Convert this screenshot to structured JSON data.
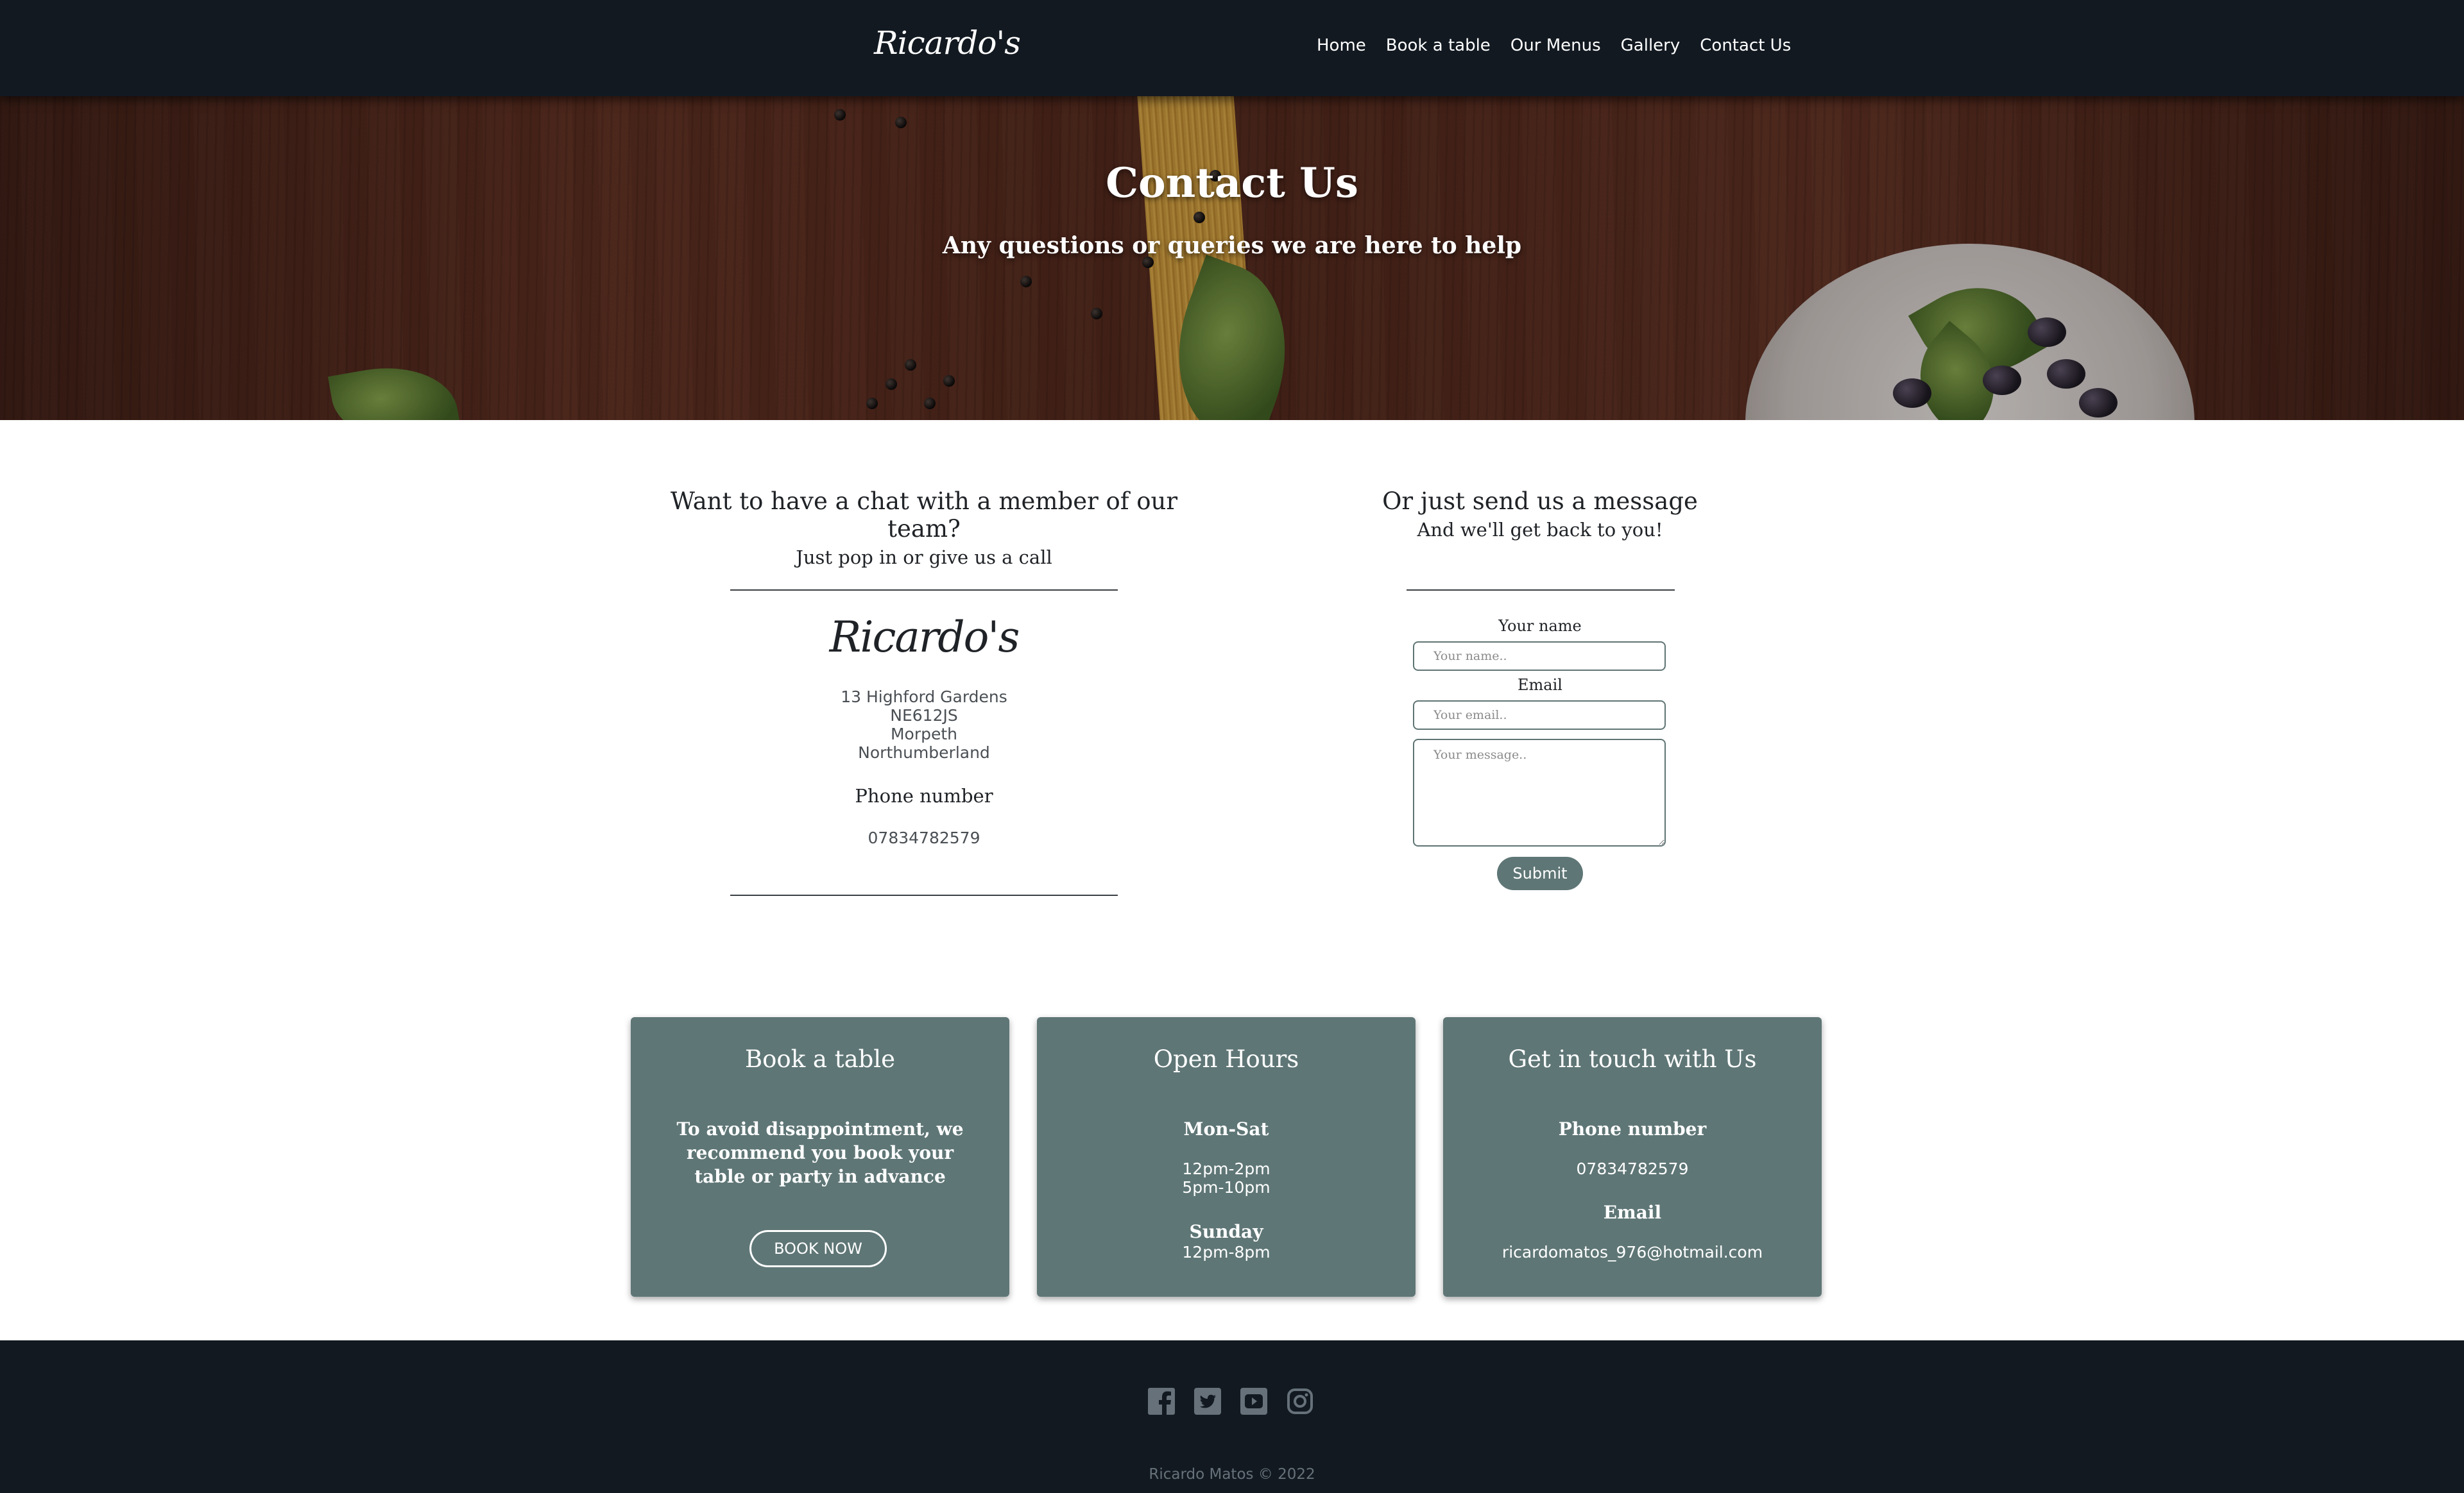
{
  "nav": {
    "brand": "Ricardo's",
    "links": [
      "Home",
      "Book a table",
      "Our Menus",
      "Gallery",
      "Contact Us"
    ]
  },
  "hero": {
    "title": "Contact Us",
    "subtitle": "Any questions or queries we are here to help"
  },
  "visit": {
    "heading": "Want to have a chat with a member of our team?",
    "subheading": "Just pop in or give us a call",
    "logo": "Ricardo's",
    "address": [
      "13 Highford Gardens",
      "NE612JS",
      "Morpeth",
      "Northumberland"
    ],
    "phone_label": "Phone number",
    "phone": "07834782579"
  },
  "message": {
    "heading": "Or just send us a message",
    "subheading": "And we'll get back to you!",
    "name_label": "Your name",
    "name_placeholder": "Your name..",
    "email_label": "Email",
    "email_placeholder": "Your email..",
    "message_placeholder": "Your message..",
    "submit": "Submit"
  },
  "cards": {
    "book": {
      "title": "Book a table",
      "text": "To avoid disappointment, we recommend you book your table or party in advance",
      "button": "BOOK NOW"
    },
    "hours": {
      "title": "Open Hours",
      "weekday_label": "Mon-Sat",
      "weekday_lunch": "12pm-2pm",
      "weekday_dinner": "5pm-10pm",
      "sunday_label": "Sunday",
      "sunday_hours": "12pm-8pm"
    },
    "contact": {
      "title": "Get in touch with Us",
      "phone_label": "Phone number",
      "phone": "07834782579",
      "email_label": "Email",
      "email": "ricardomatos_976@hotmail.com"
    }
  },
  "footer": {
    "social_icons": [
      "facebook-icon",
      "twitter-icon",
      "youtube-icon",
      "instagram-icon"
    ],
    "copyright": "Ricardo Matos © 2022"
  },
  "colors": {
    "navbar": "#121921",
    "card": "#5f7676",
    "footer": "#121921"
  }
}
